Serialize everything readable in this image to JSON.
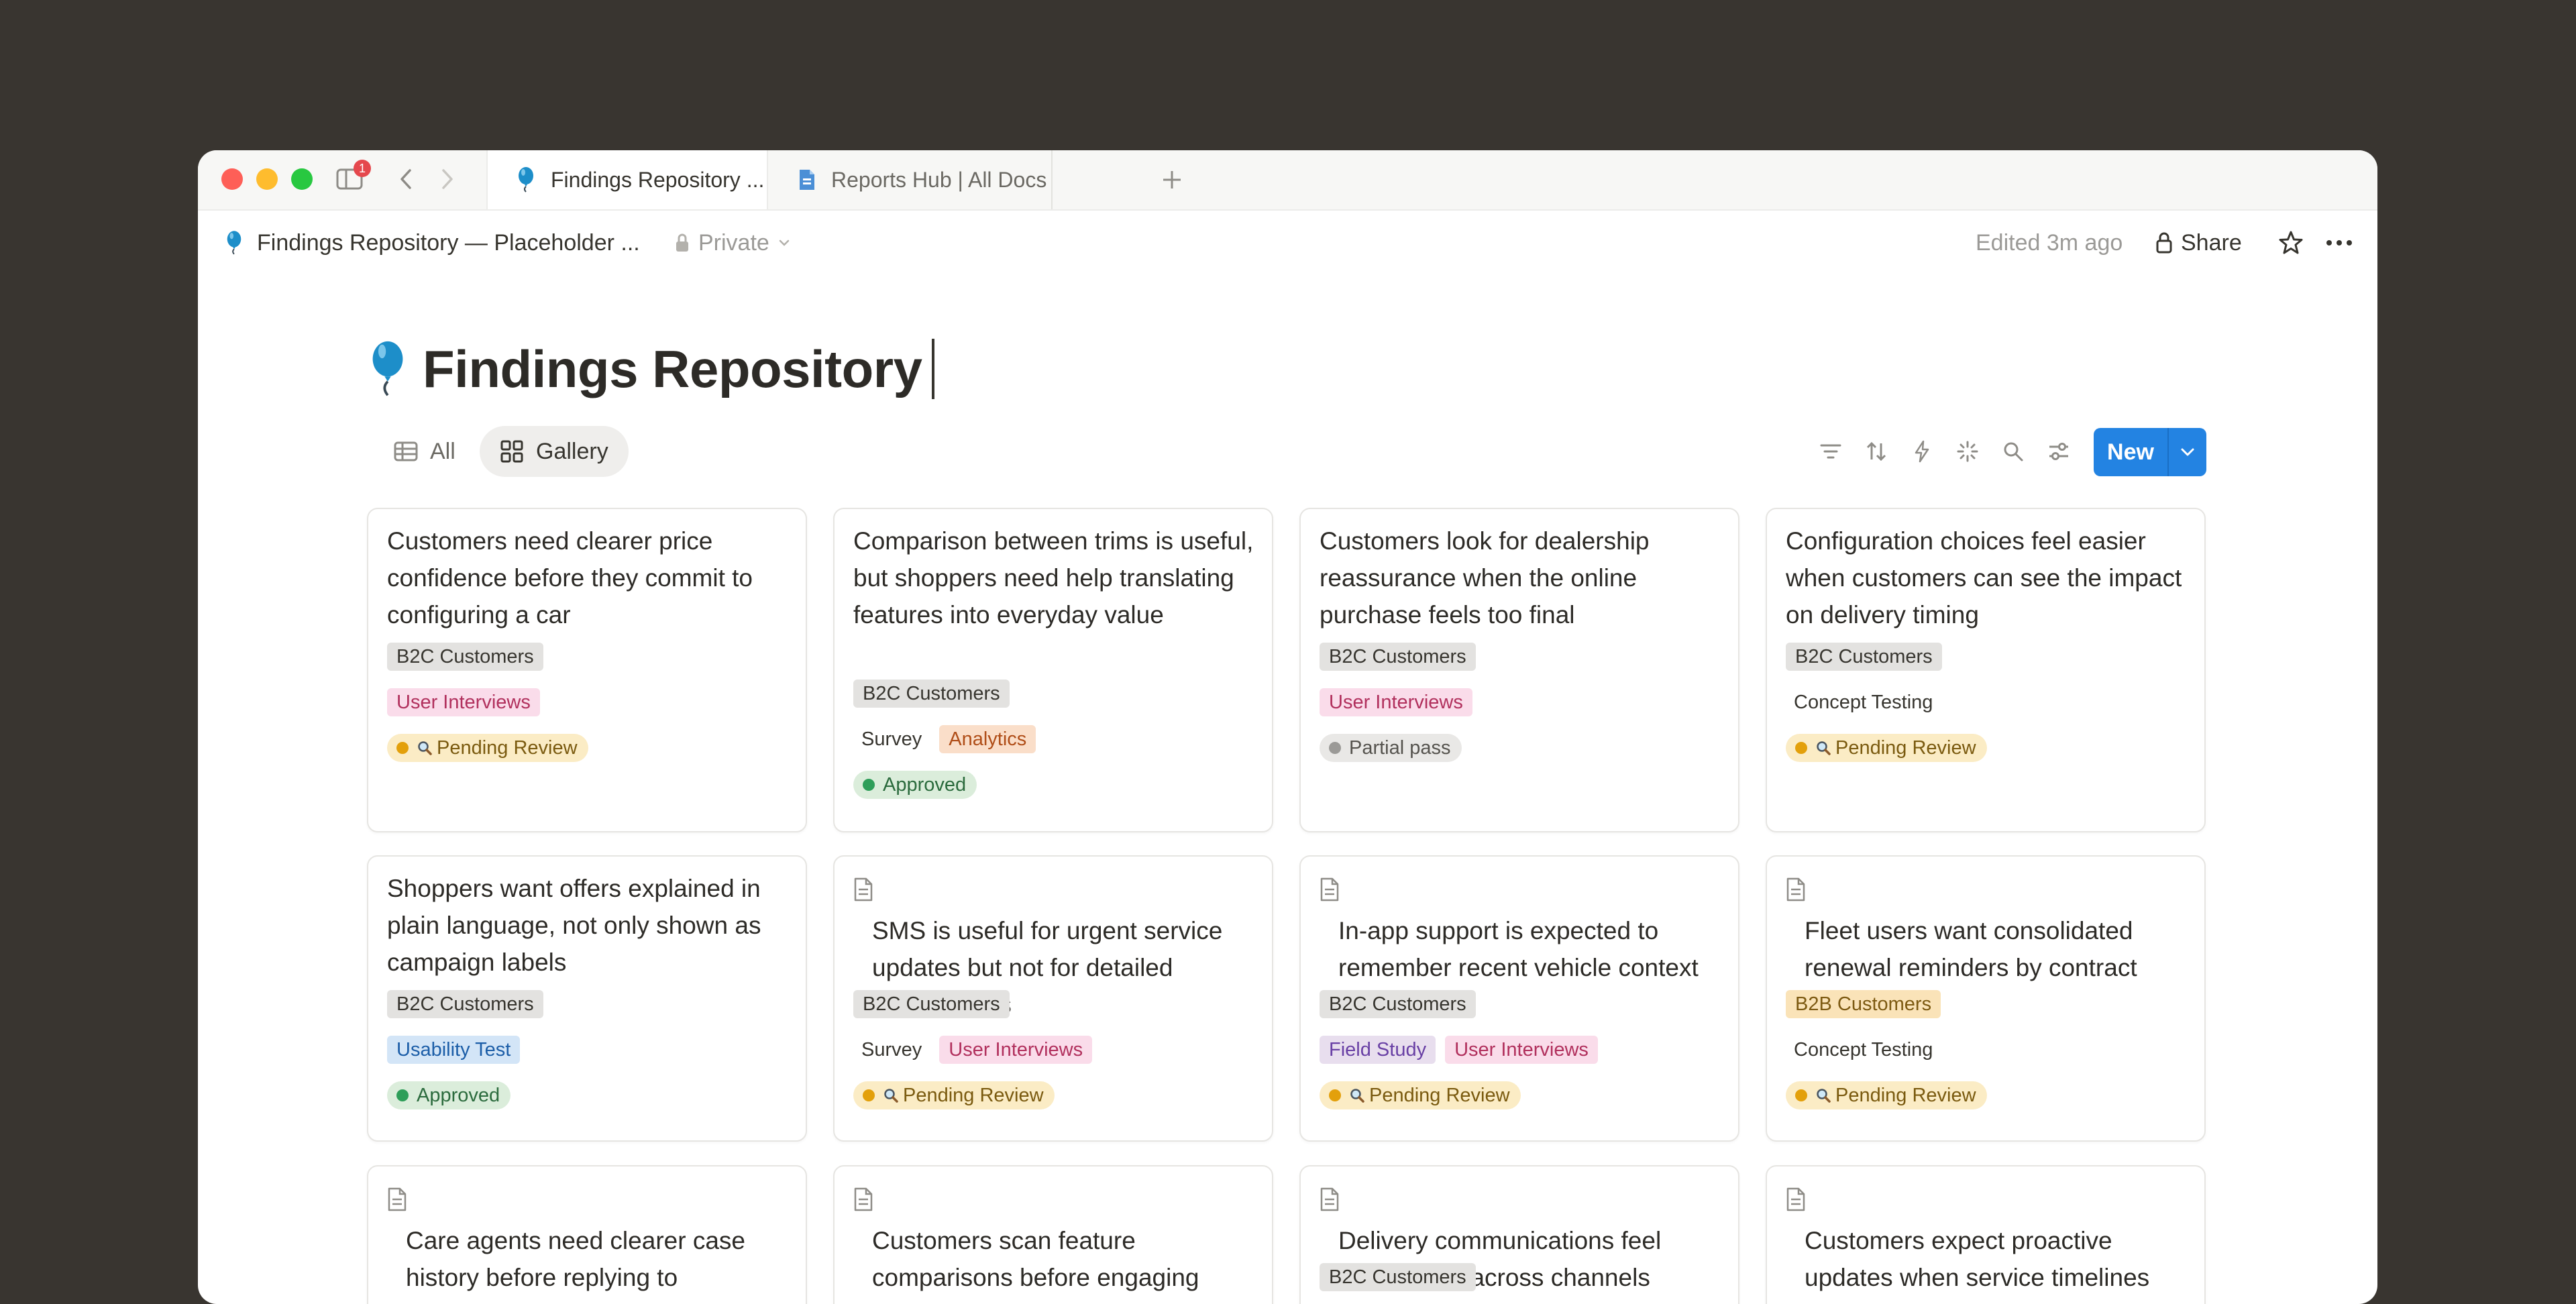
{
  "tabbar": {
    "notification_count": "1",
    "tabs": [
      {
        "label": "Findings Repository ...",
        "icon": "balloon-icon"
      },
      {
        "label": "Reports Hub | All Docs",
        "icon": "document-icon"
      }
    ]
  },
  "topbar": {
    "breadcrumb": "Findings Repository — Placeholder ...",
    "privacy": "Private",
    "edited": "Edited 3m ago",
    "share": "Share"
  },
  "page": {
    "title": "Findings Repository"
  },
  "views": {
    "all": "All",
    "gallery": "Gallery",
    "new_button": "New"
  },
  "colors": {
    "accent": "#2383e2",
    "pending": "#e3a00b",
    "approved": "#2e9e59"
  },
  "cards": [
    {
      "title": "Customers need clearer price confidence before they commit to configuring a car",
      "segment": "B2C Customers",
      "methods": [
        "User Interviews"
      ],
      "status": "Pending Review"
    },
    {
      "title": "Comparison between trims is useful, but shoppers need help translating features into everyday value",
      "segment": "B2C Customers",
      "methods": [
        "Survey",
        "Analytics"
      ],
      "status": "Approved"
    },
    {
      "title": "Customers look for dealership reassurance when the online purchase feels too final",
      "segment": "B2C Customers",
      "methods": [
        "User Interviews"
      ],
      "status": "Partial pass"
    },
    {
      "title": "Configuration choices feel easier when customers can see the impact on delivery timing",
      "segment": "B2C Customers",
      "methods": [
        "Concept Testing"
      ],
      "status": "Pending Review"
    },
    {
      "title": "Shoppers want offers explained in plain language, not only shown as campaign labels",
      "segment": "B2C Customers",
      "methods": [
        "Usability Test"
      ],
      "status": "Approved"
    },
    {
      "title": "SMS is useful for urgent service updates but not for detailed explanations",
      "segment": "B2C Customers",
      "methods": [
        "Survey",
        "User Interviews"
      ],
      "status": "Pending Review"
    },
    {
      "title": "In-app support is expected to remember recent vehicle context",
      "segment": "B2C Customers",
      "methods": [
        "Field Study",
        "User Interviews"
      ],
      "status": "Pending Review"
    },
    {
      "title": "Fleet users want consolidated renewal reminders by contract group",
      "segment": "B2B Customers",
      "methods": [
        "Concept Testing"
      ],
      "status": "Pending Review"
    },
    {
      "title": "Care agents need clearer case history before replying to customers",
      "segment": "",
      "methods": [],
      "status": ""
    },
    {
      "title": "Customers scan feature comparisons before engaging with detailed content",
      "segment": "",
      "methods": [],
      "status": ""
    },
    {
      "title": "Delivery communications feel fragmented across channels",
      "segment": "B2C Customers",
      "methods": [],
      "status": ""
    },
    {
      "title": "Customers expect proactive updates when service timelines change",
      "segment": "",
      "methods": [],
      "status": ""
    }
  ]
}
